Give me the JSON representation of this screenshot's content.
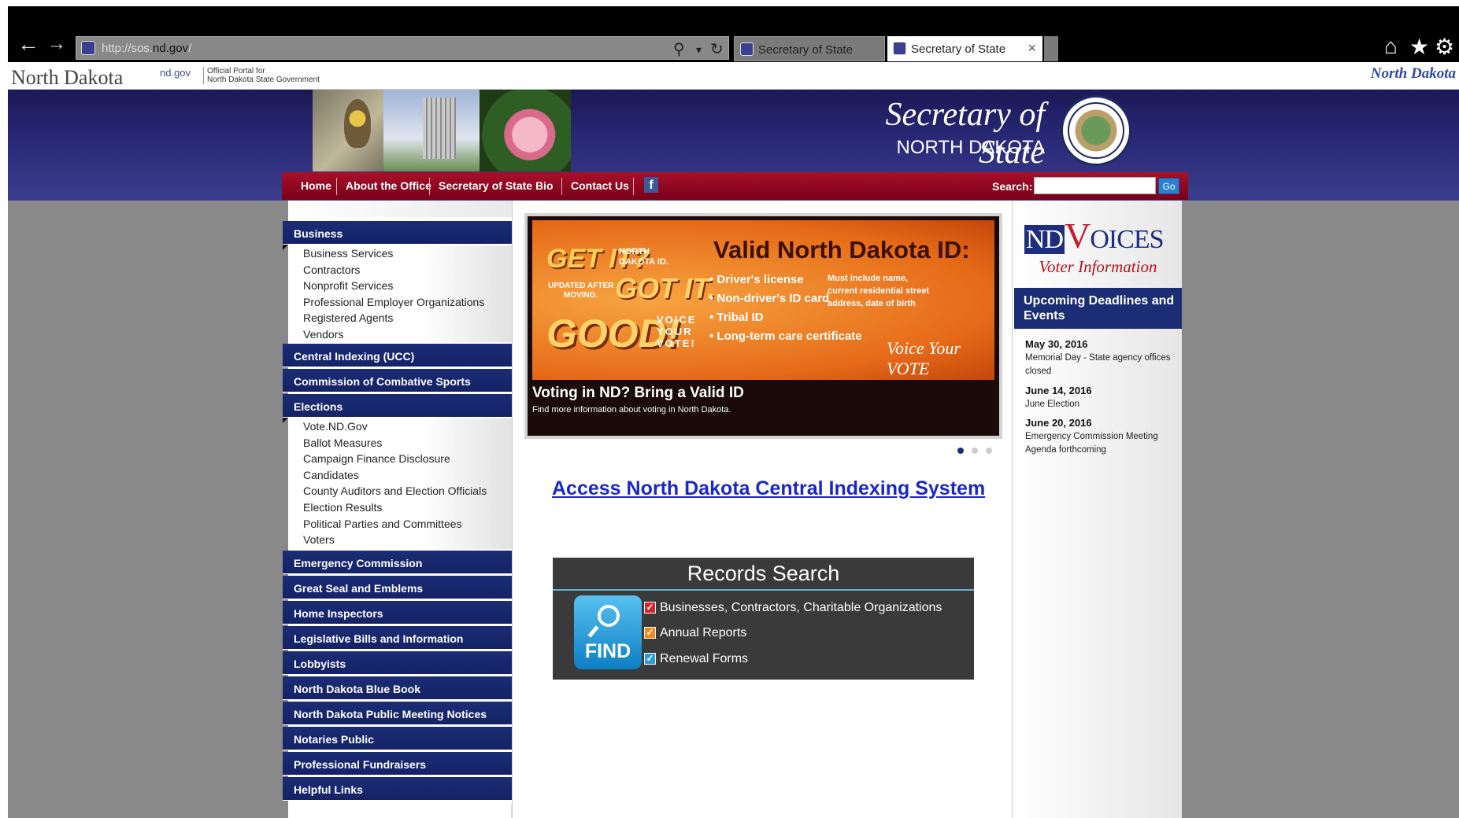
{
  "browser": {
    "url_prefix": "http://sos.",
    "url_domain": "nd.gov",
    "url_suffix": "/",
    "tabs": [
      {
        "label": "Secretary of State"
      },
      {
        "label": "Secretary of State"
      }
    ],
    "close_glyph": "×"
  },
  "portal": {
    "state": "North Dakota",
    "ndgov": "nd.gov",
    "official": "Official Portal for",
    "government": "North Dakota State Government",
    "logo": "North Dakota"
  },
  "header": {
    "title": "Secretary of State",
    "subtitle": "NORTH DAKOTA"
  },
  "topnav": {
    "items": [
      "Home",
      "About the Office",
      "Secretary of State Bio",
      "Contact Us"
    ],
    "facebook": "f",
    "search_label": "Search:",
    "go_label": "Go"
  },
  "sidebar": {
    "business": {
      "label": "Business",
      "items": [
        "Business Services",
        "Contractors",
        "Nonprofit Services",
        "Professional Employer Organizations",
        "Registered Agents",
        "Vendors"
      ]
    },
    "central_indexing": "Central Indexing (UCC)",
    "combative_sports": "Commission of Combative Sports",
    "elections": {
      "label": "Elections",
      "items": [
        "Vote.ND.Gov",
        "Ballot Measures",
        "Campaign Finance Disclosure",
        "Candidates",
        "County Auditors and Election Officials",
        "Election Results",
        "Political Parties and Committees",
        "Voters"
      ]
    },
    "sections": [
      "Emergency Commission",
      "Great Seal and Emblems",
      "Home Inspectors",
      "Legislative Bills and Information",
      "Lobbyists",
      "North Dakota Blue Book",
      "North Dakota Public Meeting Notices",
      "Notaries Public",
      "Professional Fundraisers",
      "Helpful Links"
    ]
  },
  "slide": {
    "get_it": "GET IT?",
    "north_dakota_id_1": "NORTH",
    "north_dakota_id_2": "DAKOTA ID.",
    "updated_1": "UPDATED AFTER",
    "updated_2": "MOVING.",
    "got_it": "GOT IT.",
    "good": "GOOD!",
    "voice_1": "VOICE",
    "voice_2": "YOUR",
    "voice_3": "VOTE!",
    "heading": "Valid North Dakota ID:",
    "id_types": [
      "• Driver's license",
      "• Non-driver's ID card",
      "• Tribal ID",
      "• Long-term care certificate"
    ],
    "must_1": "Must include name,",
    "must_2": "current residential street",
    "must_3": "address, date of birth",
    "voice_your_vote": "Voice Your VOTE",
    "caption": "Voting in ND? Bring a Valid ID",
    "caption_sub": "Find more information about voting in North Dakota.",
    "active_slide": 1,
    "slide_count": 3
  },
  "main": {
    "access_link": "Access North Dakota Central Indexing System"
  },
  "records": {
    "title": "Records Search",
    "find": "FIND",
    "items": [
      {
        "label": "Businesses, Contractors, Charitable Organizations",
        "color": "#d8222b"
      },
      {
        "label": "Annual Reports",
        "color": "#f08a1c"
      },
      {
        "label": "Renewal Forms",
        "color": "#2a9fd6"
      }
    ]
  },
  "rightcol": {
    "nd": "ND",
    "v": "V",
    "oices": "OICES",
    "voter_info": "Voter Information",
    "upcoming": "Upcoming Deadlines and Events",
    "events": [
      {
        "date": "May 30, 2016",
        "desc": "Memorial Day - State agency offices closed"
      },
      {
        "date": "June 14, 2016",
        "desc": "June Election"
      },
      {
        "date": "June 20, 2016",
        "desc": "Emergency Commission Meeting Agenda forthcoming"
      }
    ]
  },
  "colors": {
    "nav_blue": "#1b2d75",
    "nav_red": "#a8102a",
    "link_blue": "#1a28c9"
  }
}
